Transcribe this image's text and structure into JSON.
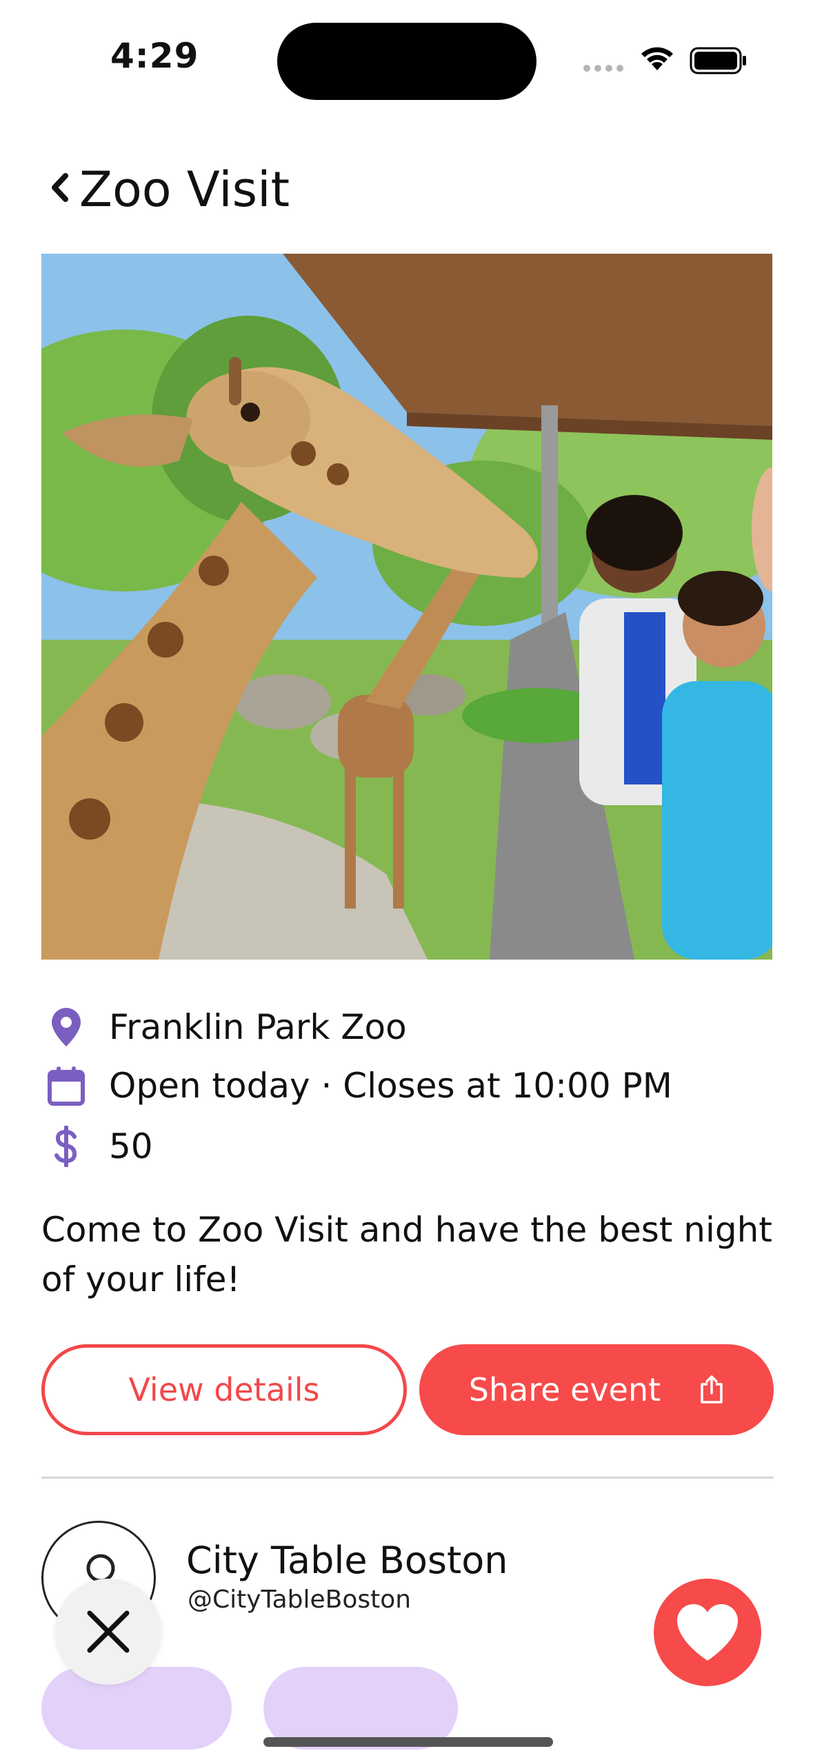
{
  "status_bar": {
    "time": "4:29",
    "icons": [
      "cellular-icon",
      "wifi-icon",
      "battery-icon"
    ]
  },
  "header": {
    "title": "Zoo Visit",
    "back_icon": "chevron-left-icon"
  },
  "event": {
    "location": "Franklin Park Zoo",
    "hours": "Open today · Closes at 10:00 PM",
    "price": "50",
    "description": "Come to Zoo Visit and have the best night of your life!",
    "icons": {
      "location": "map-pin-icon",
      "hours": "calendar-icon",
      "price": "dollar-icon"
    }
  },
  "actions": {
    "view_details": "View details",
    "share_event": "Share event",
    "share_icon": "share-icon"
  },
  "organizer": {
    "name": "City Table Boston",
    "handle": "@CityTableBoston"
  },
  "fabs": {
    "close_icon": "close-icon",
    "like_icon": "heart-icon"
  },
  "colors": {
    "accent": "#f74a4a",
    "icon_purple": "#7a5fc0",
    "chip": "#e3d1fa"
  }
}
